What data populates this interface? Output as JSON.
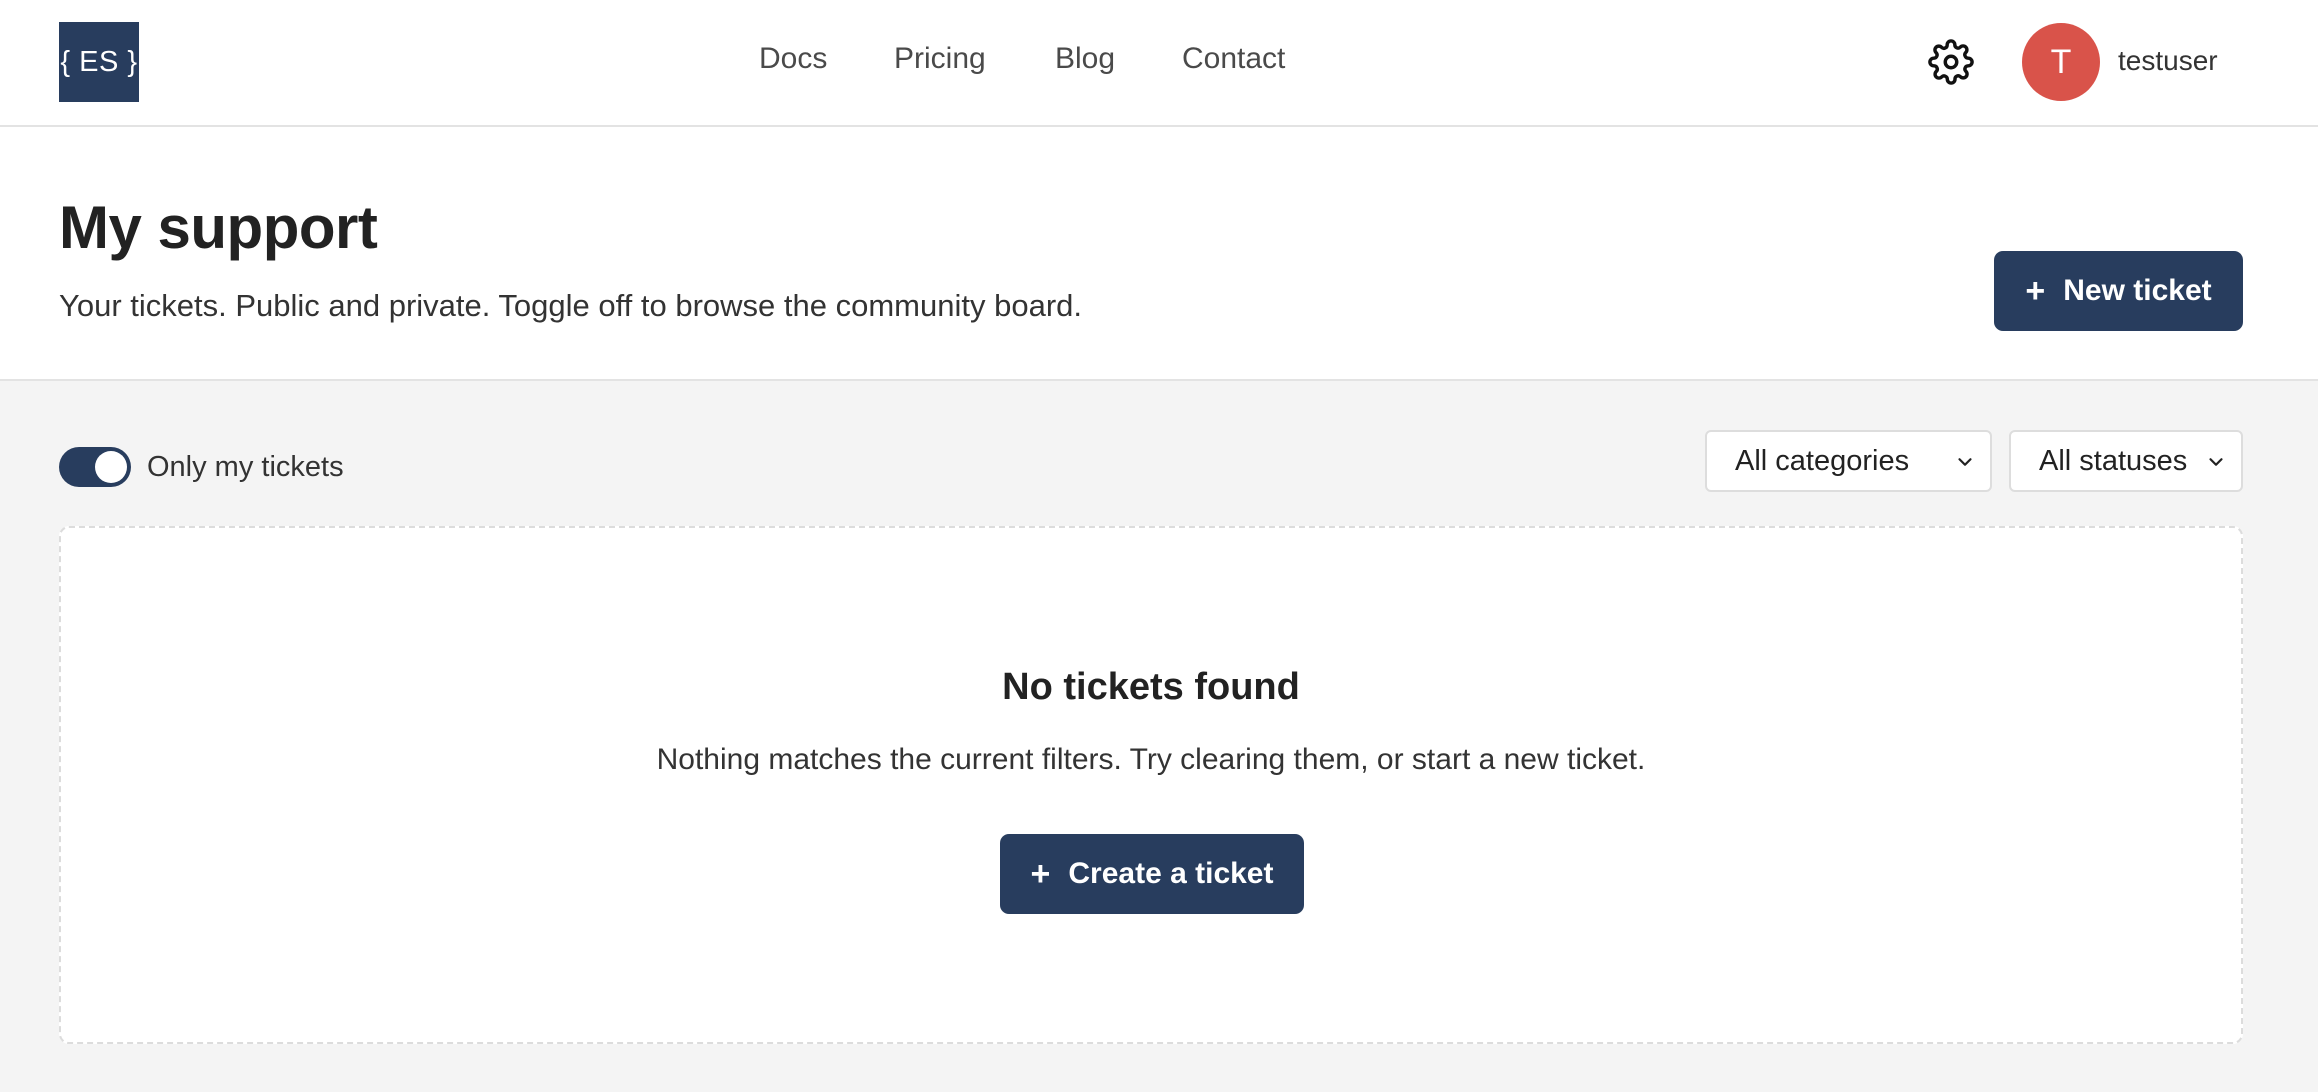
{
  "header": {
    "logo_text": "{ ES }",
    "nav": [
      {
        "label": "Docs"
      },
      {
        "label": "Pricing"
      },
      {
        "label": "Blog"
      },
      {
        "label": "Contact"
      }
    ],
    "settings_icon": "gear-icon",
    "user": {
      "avatar_initial": "T",
      "avatar_color": "#d9534a",
      "username": "testuser"
    }
  },
  "page": {
    "title": "My support",
    "subtitle": "Your tickets. Public and private. Toggle off to browse the community board.",
    "new_ticket_label": "New ticket",
    "new_ticket_icon": "plus-icon"
  },
  "filters": {
    "only_mine_label": "Only my tickets",
    "only_mine_checked": true,
    "category_selected": "All categories",
    "status_selected": "All statuses"
  },
  "empty_state": {
    "title": "No tickets found",
    "description": "Nothing matches the current filters. Try clearing them, or start a new ticket.",
    "create_label": "Create a ticket",
    "create_icon": "plus-icon"
  },
  "colors": {
    "primary": "#283d5e",
    "page_background": "#f4f4f4",
    "surface": "#ffffff"
  }
}
